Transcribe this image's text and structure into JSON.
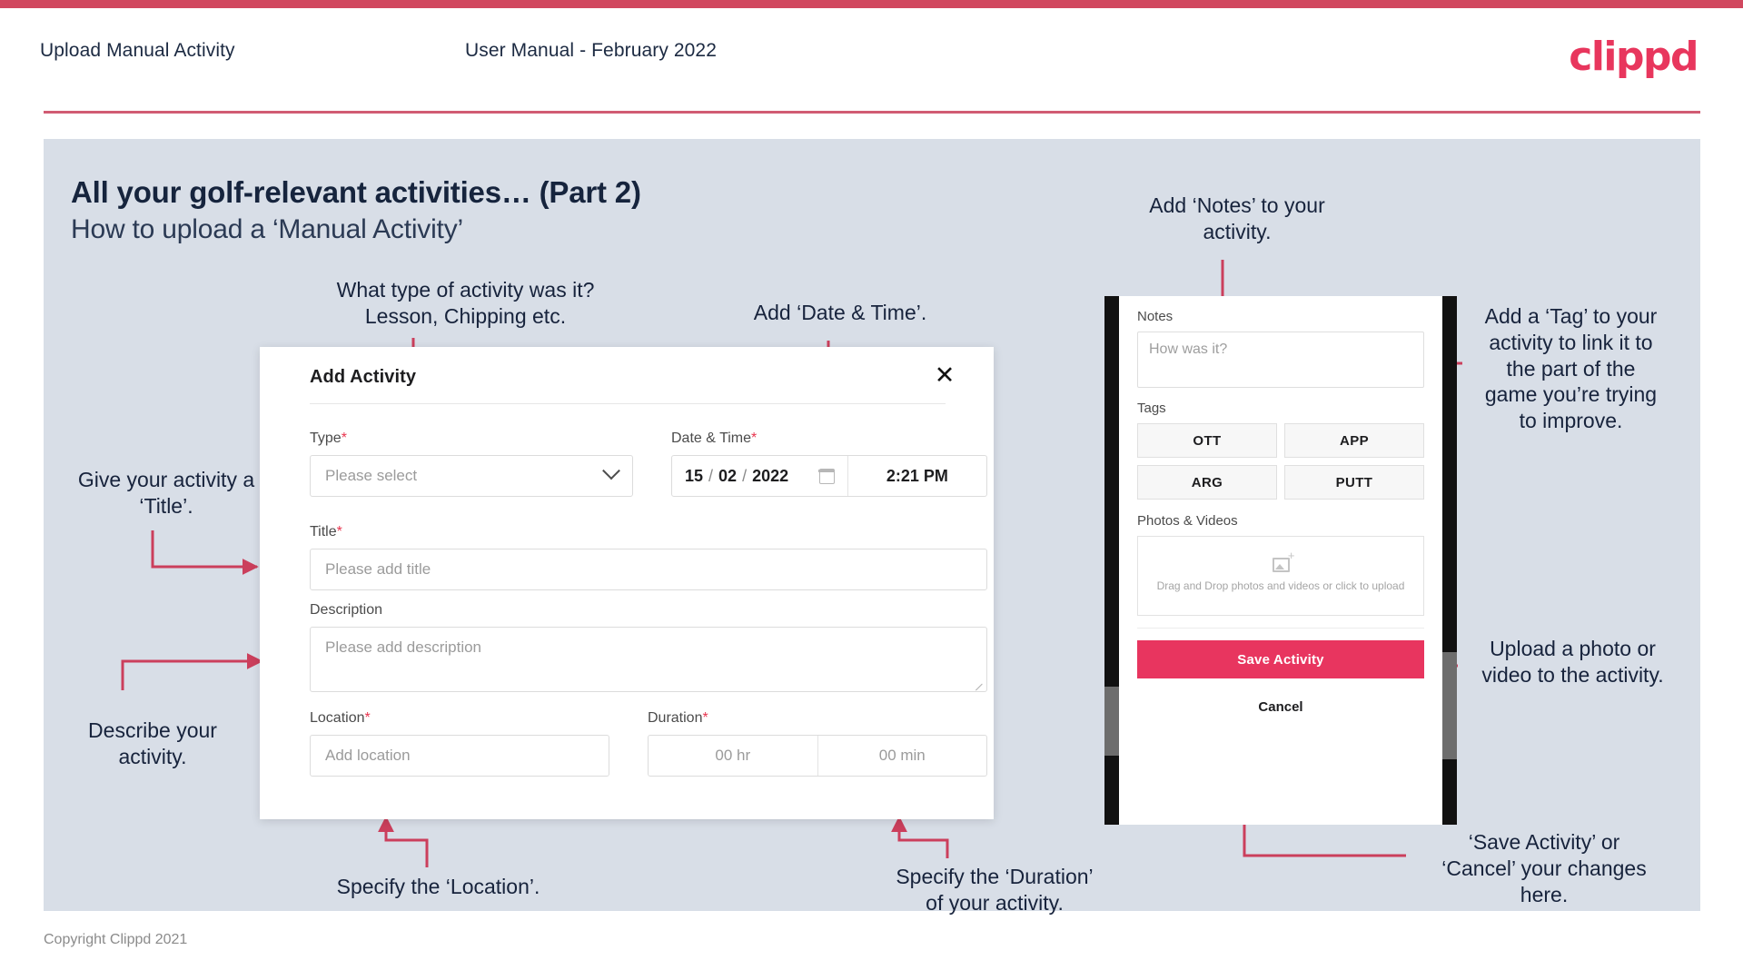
{
  "header": {
    "title": "Upload Manual Activity",
    "subtitle": "User Manual - February 2022",
    "logo": "clippd"
  },
  "slide": {
    "title": "All your golf-relevant activities… (Part 2)",
    "subtitle": "How to upload a ‘Manual Activity’"
  },
  "annotations": {
    "type": "What type of activity was it?\nLesson, Chipping etc.",
    "datetime": "Add ‘Date & Time’.",
    "title": "Give your activity a\n‘Title’.",
    "description": "Describe your\nactivity.",
    "location": "Specify the ‘Location’.",
    "duration": "Specify the ‘Duration’\nof your activity.",
    "notes": "Add ‘Notes’ to your\nactivity.",
    "tags": "Add a ‘Tag’ to your\nactivity to link it to\nthe part of the\ngame you’re trying\nto improve.",
    "upload": "Upload a photo or\nvideo to the activity.",
    "save": "‘Save Activity’ or\n‘Cancel’ your changes\nhere."
  },
  "dialog": {
    "title": "Add Activity",
    "close_icon": "close-icon",
    "fields": {
      "type": {
        "label": "Type",
        "required": "*",
        "placeholder": "Please select"
      },
      "datetime": {
        "label": "Date & Time",
        "required": "*",
        "day": "15",
        "month": "02",
        "year": "2022",
        "sep": "/",
        "time": "2:21 PM"
      },
      "title": {
        "label": "Title",
        "required": "*",
        "placeholder": "Please add title"
      },
      "description": {
        "label": "Description",
        "required": "",
        "placeholder": "Please add description"
      },
      "location": {
        "label": "Location",
        "required": "*",
        "placeholder": "Add location"
      },
      "duration": {
        "label": "Duration",
        "required": "*",
        "hours": "00 hr",
        "minutes": "00 min"
      }
    }
  },
  "phone": {
    "notes_label": "Notes",
    "notes_placeholder": "How was it?",
    "tags_label": "Tags",
    "tags": [
      "OTT",
      "APP",
      "ARG",
      "PUTT"
    ],
    "photos_label": "Photos & Videos",
    "drop_text": "Drag and Drop photos and videos or click to upload",
    "save_label": "Save Activity",
    "cancel_label": "Cancel"
  },
  "footer": {
    "copyright": "Copyright Clippd 2021"
  },
  "colors": {
    "brand": "#e8355f",
    "accent_rule": "#c9405a",
    "slide_bg": "#d8dee7",
    "ink": "#16243d",
    "arrow": "#cb3f5c"
  }
}
